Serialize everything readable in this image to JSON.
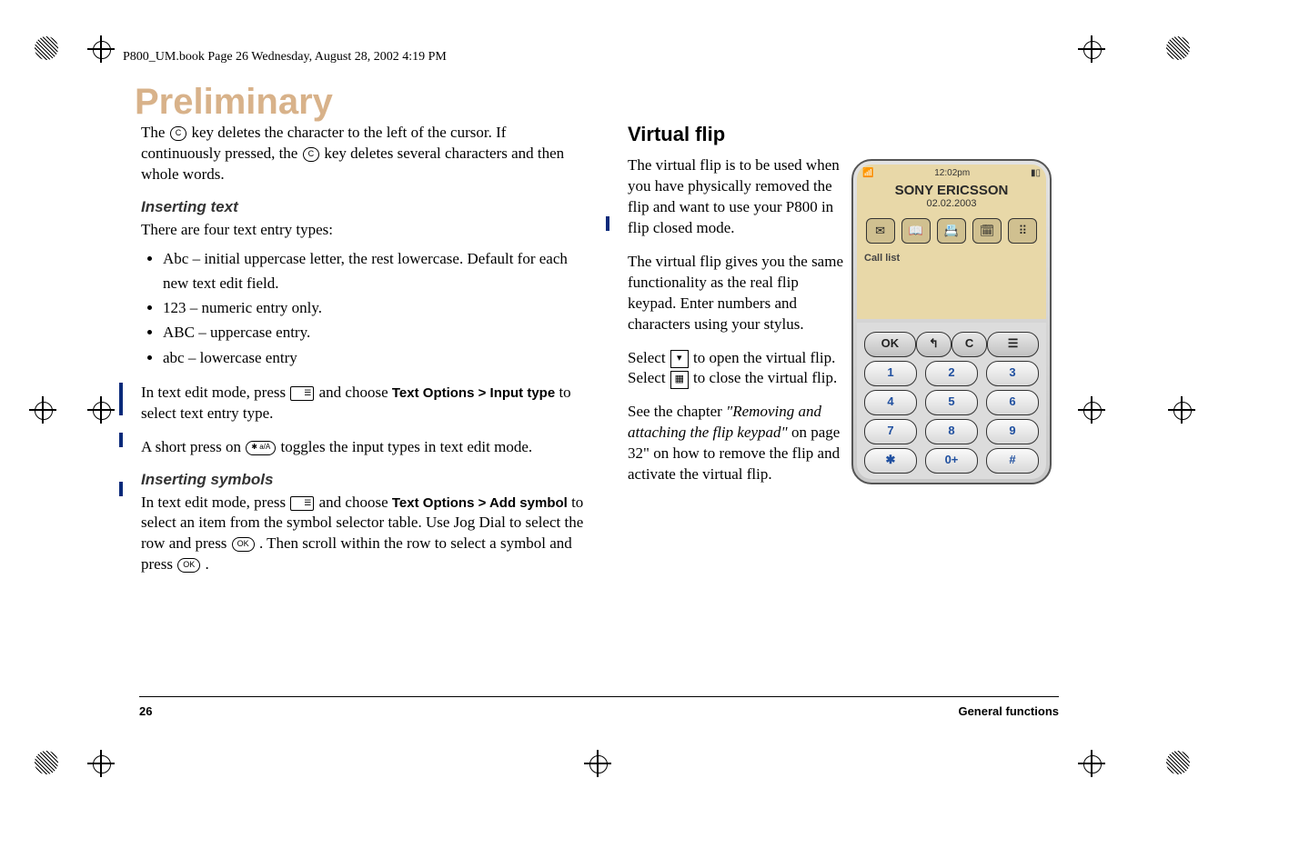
{
  "header": "P800_UM.book  Page 26  Wednesday, August 28, 2002  4:19 PM",
  "watermark": "Preliminary",
  "left": {
    "intro": "The  key deletes the character to the left of the cursor. If continuously pressed, the  key deletes several characters and then whole words.",
    "introA": "The ",
    "introB": " key deletes the character to the left of the cursor. If continuously pressed, the ",
    "introC": " key deletes several characters and then whole words.",
    "insertingTextHead": "Inserting text",
    "insertingTextBody": "There are four text entry types:",
    "bullets": [
      "Abc – initial uppercase letter, the rest lowercase. Default for each new text edit field.",
      "123 – numeric entry only.",
      "ABC – uppercase entry.",
      "abc – lowercase entry"
    ],
    "textEditA": "In text edit mode, press ",
    "textEditB": " and choose ",
    "textOptionsInput": "Text Options > Input type",
    "textEditC": " to select text entry type.",
    "shortPressA": "A short press on  ",
    "shortPressB": " toggles the input types in text edit mode.",
    "insertingSymbolsHead": "Inserting symbols",
    "symA": "In text edit mode, press ",
    "symB": " and choose ",
    "textOptionsAdd": "Text Options > Add symbol",
    "symC": " to select an item from the symbol selector table. Use Jog Dial to select the row and press ",
    "symD": ". Then scroll within the row to select a symbol and press ",
    "symE": "."
  },
  "right": {
    "h2": "Virtual flip",
    "p1": "The virtual flip is to be used when you have physically removed the flip and want to use your P800 in flip closed mode.",
    "p2": "The virtual flip gives you the same functionality as the real flip keypad. Enter numbers and characters using your stylus.",
    "p3a": "Select ",
    "p3b": " to open the virtual flip. Select ",
    "p3c": " to close the virtual flip.",
    "p4a": "See the chapter ",
    "p4ref": "\"Removing and attaching the flip keypad\"",
    "p4b": " on page 32\" on how to remove the flip and activate the virtual flip."
  },
  "keys": {
    "c": "C",
    "ok": "OK",
    "star": "✱ a/A",
    "menu": "☰"
  },
  "phone": {
    "time": "12:02pm",
    "brand": "SONY ERICSSON",
    "date": "02.02.2003",
    "callList": "Call list",
    "icons": [
      "✉",
      "📖",
      "📇",
      "🗓",
      "⠿"
    ],
    "row1": [
      "OK",
      "↰",
      "C",
      "☰"
    ],
    "row2": [
      "1",
      "2",
      "3"
    ],
    "row3": [
      "4",
      "5",
      "6"
    ],
    "row4": [
      "7",
      "8",
      "9"
    ],
    "row5": [
      "✱",
      "0+",
      "#"
    ]
  },
  "footer": {
    "page": "26",
    "chapter": "General functions"
  }
}
